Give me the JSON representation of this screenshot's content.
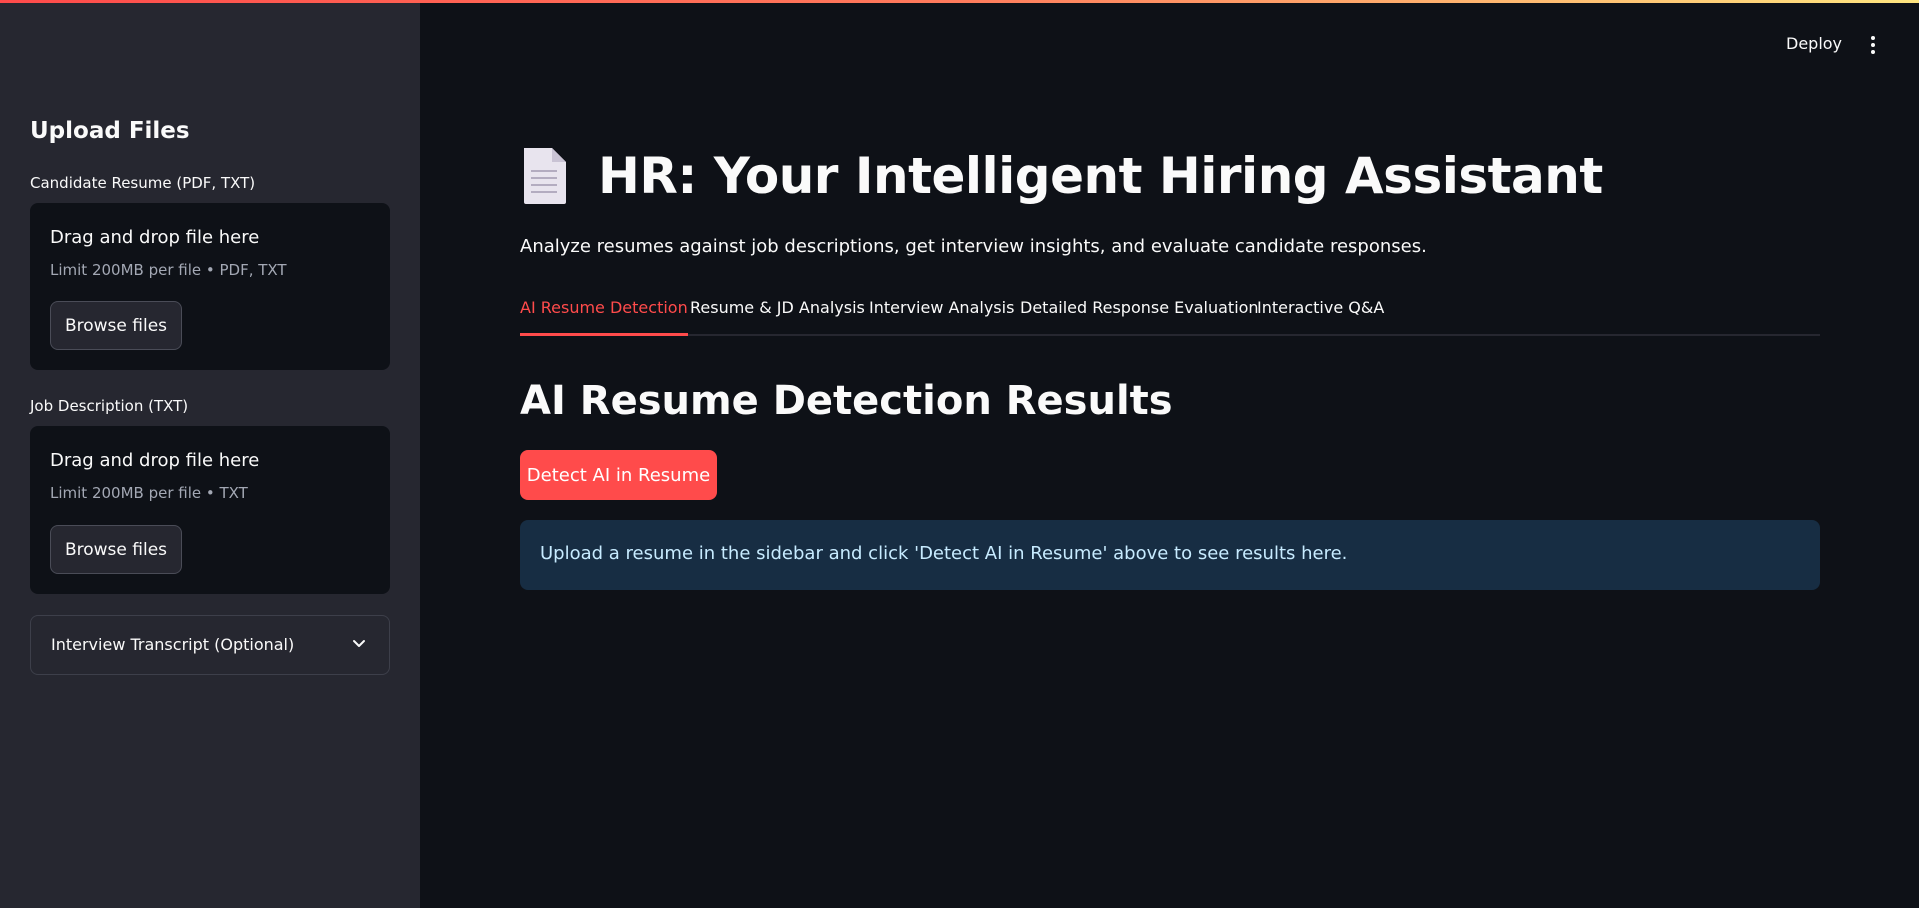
{
  "sidebar": {
    "title": "Upload Files",
    "resume": {
      "label": "Candidate Resume (PDF, TXT)",
      "dropzone_main": "Drag and drop file here",
      "dropzone_sub": "Limit 200MB per file • PDF, TXT",
      "browse_label": "Browse files"
    },
    "jd": {
      "label": "Job Description (TXT)",
      "dropzone_main": "Drag and drop file here",
      "dropzone_sub": "Limit 200MB per file • TXT",
      "browse_label": "Browse files"
    },
    "transcript_expander": "Interview Transcript (Optional)"
  },
  "header": {
    "deploy_label": "Deploy",
    "menu_icon": "vertical-ellipsis-icon"
  },
  "main": {
    "title_icon": "document-icon",
    "title": "HR: Your Intelligent Hiring Assistant",
    "subtitle": "Analyze resumes against job descriptions, get interview insights, and evaluate candidate responses.",
    "tabs": [
      {
        "label": "AI Resume Detection",
        "active": true
      },
      {
        "label": "Resume & JD Analysis",
        "active": false
      },
      {
        "label": "Interview Analysis",
        "active": false
      },
      {
        "label": "Detailed Response Evaluation",
        "active": false
      },
      {
        "label": "Interactive Q&A",
        "active": false
      }
    ],
    "section_title": "AI Resume Detection Results",
    "detect_button": "Detect AI in Resume",
    "info_message": "Upload a resume in the sidebar and click 'Detect AI in Resume' above to see results here."
  },
  "colors": {
    "accent": "#ff4b4b",
    "background": "#0e1117",
    "sidebar_bg": "#262730",
    "info_bg": "#172d43",
    "info_text": "#c7ebff"
  }
}
